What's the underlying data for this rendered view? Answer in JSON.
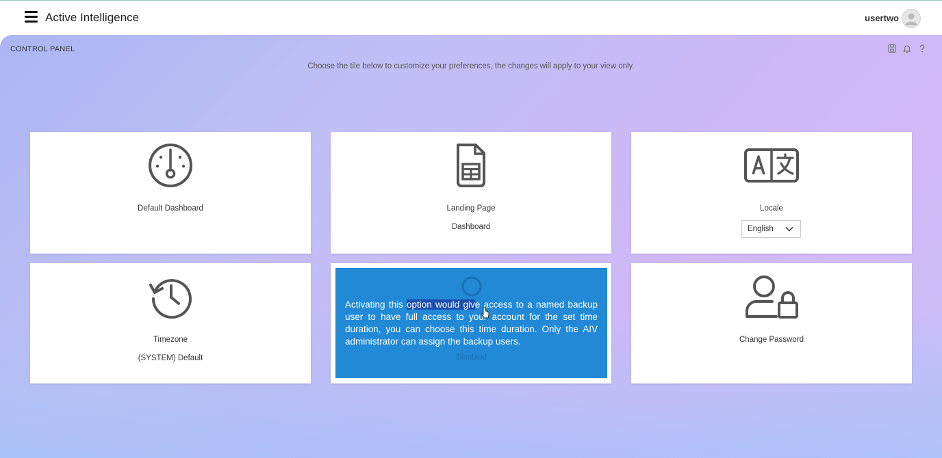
{
  "header": {
    "app_title": "Active Intelligence",
    "user_name": "usertwo"
  },
  "control_panel": {
    "title": "CONTROL PANEL",
    "instruction": "Choose the tile below to customize your preferences, the changes will apply to your view only.",
    "toolbar_icons": [
      "save-icon",
      "bell-icon",
      "help-icon"
    ]
  },
  "tiles": {
    "default_dashboard": {
      "label": "Default Dashboard",
      "icon": "dashboard-gauge-icon"
    },
    "landing_page": {
      "label": "Landing Page",
      "value": "Dashboard",
      "icon": "document-table-icon"
    },
    "locale": {
      "label": "Locale",
      "value": "English",
      "icon": "translate-icon"
    },
    "timezone": {
      "label": "Timezone",
      "value": "(SYSTEM) Default",
      "icon": "history-clock-icon"
    },
    "backup": {
      "value": "Disabled",
      "tooltip_before": "Activating this ",
      "tooltip_highlight": "option would giv",
      "tooltip_after": "e access to a named backup user to have full access to your account for the set time duration, you can choose this time duration. Only the AIV administrator can assign the backup users.",
      "icon": "backup-circle-icon"
    },
    "change_password": {
      "label": "Change Password",
      "icon": "user-lock-icon"
    }
  },
  "colors": {
    "overlay_blue": "#2189d6",
    "highlight": "#1c4fb0"
  }
}
